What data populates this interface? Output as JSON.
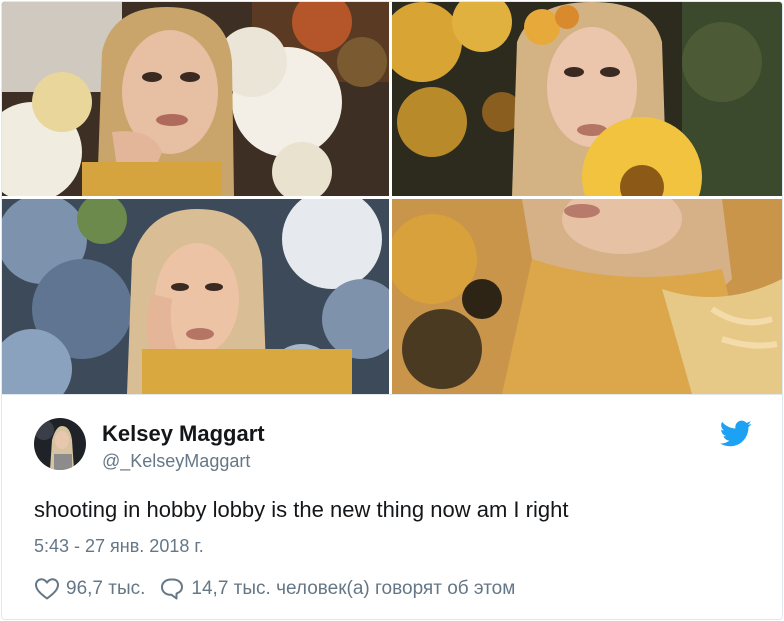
{
  "tweet": {
    "author_name": "Kelsey Maggart",
    "author_handle": "@_KelseyMaggart",
    "text": "shooting in hobby lobby is the new thing now am I right",
    "timestamp": "5:43 - 27 янв. 2018 г.",
    "likes_count": "96,7 тыс.",
    "conversation_label": "14,7 тыс. человек(а) говорят об этом"
  },
  "media": {
    "photo_count": 4,
    "info_icon": "info-icon"
  },
  "icons": {
    "brand": "twitter-bird-icon",
    "like": "heart-icon",
    "reply": "speech-bubble-icon"
  },
  "colors": {
    "text_primary": "#14171a",
    "text_secondary": "#657786",
    "twitter_blue": "#1da1f2",
    "border": "#e1e8ed"
  }
}
